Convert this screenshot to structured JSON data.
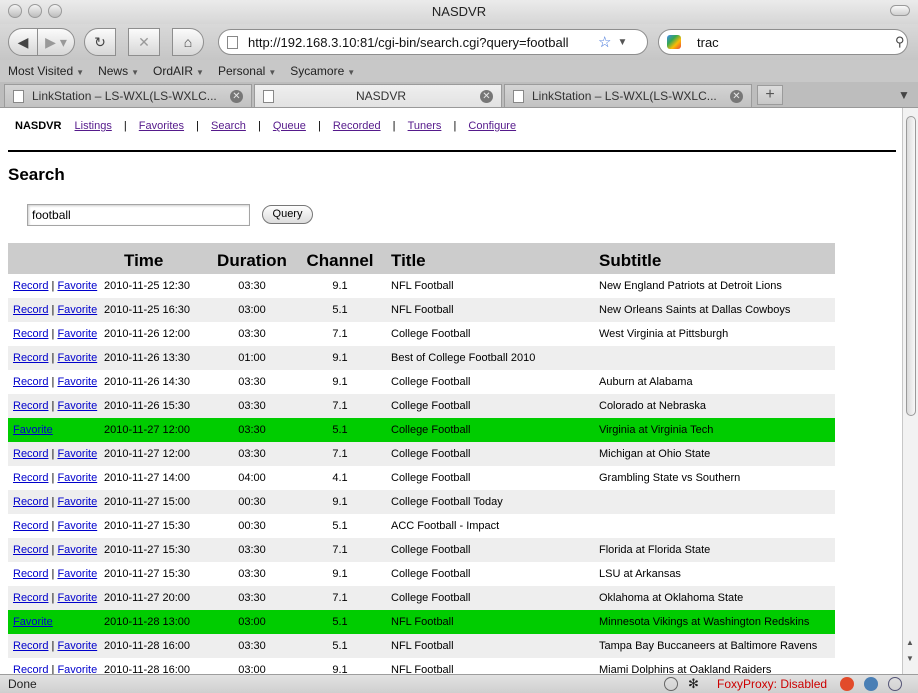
{
  "window": {
    "title": "NASDVR"
  },
  "toolbar": {
    "url": "http://192.168.3.10:81/cgi-bin/search.cgi?query=football",
    "search_value": "trac"
  },
  "bookmarks": [
    "Most Visited",
    "News",
    "OrdAIR",
    "Personal",
    "Sycamore"
  ],
  "tabs": [
    {
      "label": "LinkStation – LS-WXL(LS-WXLC..."
    },
    {
      "label": "NASDVR"
    },
    {
      "label": "LinkStation – LS-WXL(LS-WXLC..."
    }
  ],
  "page": {
    "brand": "NASDVR",
    "nav": [
      "Listings",
      "Favorites",
      "Search",
      "Queue",
      "Recorded",
      "Tuners",
      "Configure"
    ],
    "heading": "Search",
    "query_value": "football",
    "query_button": "Query",
    "columns": [
      "",
      "Time",
      "Duration",
      "Channel",
      "Title",
      "Subtitle"
    ],
    "record_label": "Record",
    "favorite_label": "Favorite",
    "rows": [
      {
        "time": "2010-11-25 12:30",
        "duration": "03:30",
        "channel": "9.1",
        "title": "NFL Football",
        "subtitle": "New England Patriots at Detroit Lions",
        "highlight": false
      },
      {
        "time": "2010-11-25 16:30",
        "duration": "03:00",
        "channel": "5.1",
        "title": "NFL Football",
        "subtitle": "New Orleans Saints at Dallas Cowboys",
        "highlight": false
      },
      {
        "time": "2010-11-26 12:00",
        "duration": "03:30",
        "channel": "7.1",
        "title": "College Football",
        "subtitle": "West Virginia at Pittsburgh",
        "highlight": false
      },
      {
        "time": "2010-11-26 13:30",
        "duration": "01:00",
        "channel": "9.1",
        "title": "Best of College Football 2010",
        "subtitle": "",
        "highlight": false
      },
      {
        "time": "2010-11-26 14:30",
        "duration": "03:30",
        "channel": "9.1",
        "title": "College Football",
        "subtitle": "Auburn at Alabama",
        "highlight": false
      },
      {
        "time": "2010-11-26 15:30",
        "duration": "03:30",
        "channel": "7.1",
        "title": "College Football",
        "subtitle": "Colorado at Nebraska",
        "highlight": false
      },
      {
        "time": "2010-11-27 12:00",
        "duration": "03:30",
        "channel": "5.1",
        "title": "College Football",
        "subtitle": "Virginia at Virginia Tech",
        "highlight": true
      },
      {
        "time": "2010-11-27 12:00",
        "duration": "03:30",
        "channel": "7.1",
        "title": "College Football",
        "subtitle": "Michigan at Ohio State",
        "highlight": false
      },
      {
        "time": "2010-11-27 14:00",
        "duration": "04:00",
        "channel": "4.1",
        "title": "College Football",
        "subtitle": "Grambling State vs Southern",
        "highlight": false
      },
      {
        "time": "2010-11-27 15:00",
        "duration": "00:30",
        "channel": "9.1",
        "title": "College Football Today",
        "subtitle": "",
        "highlight": false
      },
      {
        "time": "2010-11-27 15:30",
        "duration": "00:30",
        "channel": "5.1",
        "title": "ACC Football - Impact",
        "subtitle": "",
        "highlight": false
      },
      {
        "time": "2010-11-27 15:30",
        "duration": "03:30",
        "channel": "7.1",
        "title": "College Football",
        "subtitle": "Florida at Florida State",
        "highlight": false
      },
      {
        "time": "2010-11-27 15:30",
        "duration": "03:30",
        "channel": "9.1",
        "title": "College Football",
        "subtitle": "LSU at Arkansas",
        "highlight": false
      },
      {
        "time": "2010-11-27 20:00",
        "duration": "03:30",
        "channel": "7.1",
        "title": "College Football",
        "subtitle": "Oklahoma at Oklahoma State",
        "highlight": false
      },
      {
        "time": "2010-11-28 13:00",
        "duration": "03:00",
        "channel": "5.1",
        "title": "NFL Football",
        "subtitle": "Minnesota Vikings at Washington Redskins",
        "highlight": true
      },
      {
        "time": "2010-11-28 16:00",
        "duration": "03:30",
        "channel": "5.1",
        "title": "NFL Football",
        "subtitle": "Tampa Bay Buccaneers at Baltimore Ravens",
        "highlight": false
      },
      {
        "time": "2010-11-28 16:00",
        "duration": "03:00",
        "channel": "9.1",
        "title": "NFL Football",
        "subtitle": "Miami Dolphins at Oakland Raiders",
        "highlight": false
      }
    ]
  },
  "status": {
    "text": "Done",
    "proxy": "FoxyProxy: Disabled"
  },
  "colors": {
    "highlight_row": "#00cc00",
    "stripe_row": "#eeeeee",
    "header_row": "#cccccc",
    "link": "#0000cc",
    "visited_link": "#551a8b",
    "proxy_text": "#cc0000"
  }
}
